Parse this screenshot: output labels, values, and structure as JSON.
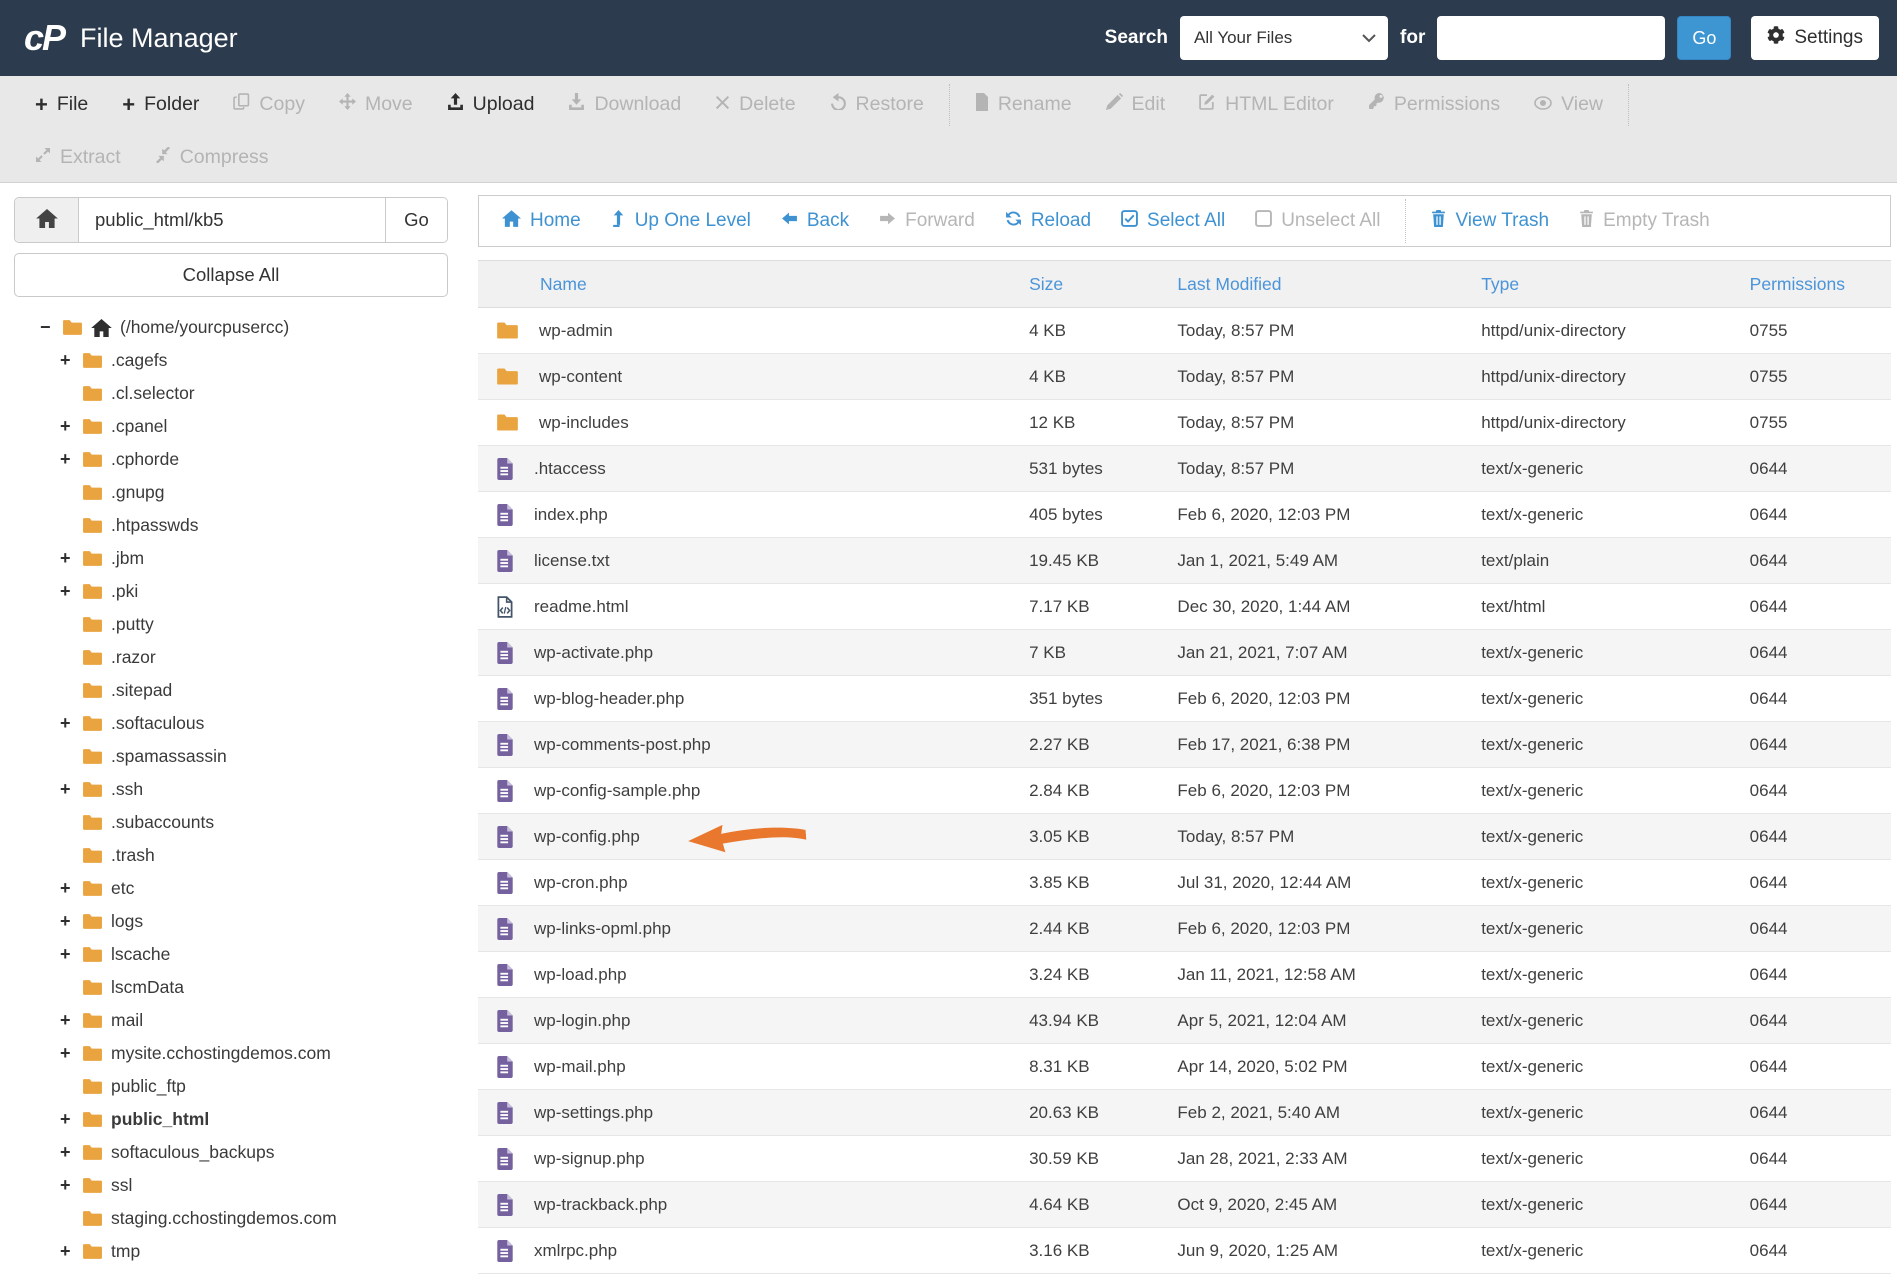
{
  "header": {
    "logo_text": "cP",
    "app_title": "File Manager",
    "search_label": "Search",
    "search_scope": "All Your Files",
    "for_label": "for",
    "search_placeholder": "",
    "go_label": "Go",
    "settings_label": "Settings"
  },
  "toolbar": {
    "file": "File",
    "folder": "Folder",
    "copy": "Copy",
    "move": "Move",
    "upload": "Upload",
    "download": "Download",
    "delete": "Delete",
    "restore": "Restore",
    "rename": "Rename",
    "edit": "Edit",
    "html_editor": "HTML Editor",
    "permissions": "Permissions",
    "view": "View",
    "extract": "Extract",
    "compress": "Compress"
  },
  "sidebar": {
    "path_value": "public_html/kb5",
    "go_label": "Go",
    "collapse_all_label": "Collapse All",
    "tree": [
      {
        "toggle": "-",
        "label": "(/home/yourcpusercc)",
        "root": true
      },
      {
        "toggle": "+",
        "label": ".cagefs"
      },
      {
        "toggle": "",
        "label": ".cl.selector"
      },
      {
        "toggle": "+",
        "label": ".cpanel"
      },
      {
        "toggle": "+",
        "label": ".cphorde"
      },
      {
        "toggle": "",
        "label": ".gnupg"
      },
      {
        "toggle": "",
        "label": ".htpasswds"
      },
      {
        "toggle": "+",
        "label": ".jbm"
      },
      {
        "toggle": "+",
        "label": ".pki"
      },
      {
        "toggle": "",
        "label": ".putty"
      },
      {
        "toggle": "",
        "label": ".razor"
      },
      {
        "toggle": "",
        "label": ".sitepad"
      },
      {
        "toggle": "+",
        "label": ".softaculous"
      },
      {
        "toggle": "",
        "label": ".spamassassin"
      },
      {
        "toggle": "+",
        "label": ".ssh"
      },
      {
        "toggle": "",
        "label": ".subaccounts"
      },
      {
        "toggle": "",
        "label": ".trash"
      },
      {
        "toggle": "+",
        "label": "etc"
      },
      {
        "toggle": "+",
        "label": "logs"
      },
      {
        "toggle": "+",
        "label": "lscache"
      },
      {
        "toggle": "",
        "label": "lscmData"
      },
      {
        "toggle": "+",
        "label": "mail"
      },
      {
        "toggle": "+",
        "label": "mysite.cchostingdemos.com"
      },
      {
        "toggle": "",
        "label": "public_ftp"
      },
      {
        "toggle": "+",
        "label": "public_html",
        "bold": true
      },
      {
        "toggle": "+",
        "label": "softaculous_backups"
      },
      {
        "toggle": "+",
        "label": "ssl"
      },
      {
        "toggle": "",
        "label": "staging.cchostingdemos.com"
      },
      {
        "toggle": "+",
        "label": "tmp"
      }
    ]
  },
  "filepane": {
    "nav": {
      "home": "Home",
      "up": "Up One Level",
      "back": "Back",
      "forward": "Forward",
      "reload": "Reload",
      "select_all": "Select All",
      "unselect_all": "Unselect All",
      "view_trash": "View Trash",
      "empty_trash": "Empty Trash"
    },
    "columns": [
      "Name",
      "Size",
      "Last Modified",
      "Type",
      "Permissions"
    ],
    "rows": [
      {
        "icon": "folder",
        "name": "wp-admin",
        "size": "4 KB",
        "modified": "Today, 8:57 PM",
        "type": "httpd/unix-directory",
        "perms": "0755"
      },
      {
        "icon": "folder",
        "name": "wp-content",
        "size": "4 KB",
        "modified": "Today, 8:57 PM",
        "type": "httpd/unix-directory",
        "perms": "0755"
      },
      {
        "icon": "folder",
        "name": "wp-includes",
        "size": "12 KB",
        "modified": "Today, 8:57 PM",
        "type": "httpd/unix-directory",
        "perms": "0755"
      },
      {
        "icon": "doc",
        "name": ".htaccess",
        "size": "531 bytes",
        "modified": "Today, 8:57 PM",
        "type": "text/x-generic",
        "perms": "0644"
      },
      {
        "icon": "doc",
        "name": "index.php",
        "size": "405 bytes",
        "modified": "Feb 6, 2020, 12:03 PM",
        "type": "text/x-generic",
        "perms": "0644"
      },
      {
        "icon": "doc",
        "name": "license.txt",
        "size": "19.45 KB",
        "modified": "Jan 1, 2021, 5:49 AM",
        "type": "text/plain",
        "perms": "0644"
      },
      {
        "icon": "code",
        "name": "readme.html",
        "size": "7.17 KB",
        "modified": "Dec 30, 2020, 1:44 AM",
        "type": "text/html",
        "perms": "0644"
      },
      {
        "icon": "doc",
        "name": "wp-activate.php",
        "size": "7 KB",
        "modified": "Jan 21, 2021, 7:07 AM",
        "type": "text/x-generic",
        "perms": "0644"
      },
      {
        "icon": "doc",
        "name": "wp-blog-header.php",
        "size": "351 bytes",
        "modified": "Feb 6, 2020, 12:03 PM",
        "type": "text/x-generic",
        "perms": "0644"
      },
      {
        "icon": "doc",
        "name": "wp-comments-post.php",
        "size": "2.27 KB",
        "modified": "Feb 17, 2021, 6:38 PM",
        "type": "text/x-generic",
        "perms": "0644"
      },
      {
        "icon": "doc",
        "name": "wp-config-sample.php",
        "size": "2.84 KB",
        "modified": "Feb 6, 2020, 12:03 PM",
        "type": "text/x-generic",
        "perms": "0644"
      },
      {
        "icon": "doc",
        "name": "wp-config.php",
        "size": "3.05 KB",
        "modified": "Today, 8:57 PM",
        "type": "text/x-generic",
        "perms": "0644",
        "arrow": true
      },
      {
        "icon": "doc",
        "name": "wp-cron.php",
        "size": "3.85 KB",
        "modified": "Jul 31, 2020, 12:44 AM",
        "type": "text/x-generic",
        "perms": "0644"
      },
      {
        "icon": "doc",
        "name": "wp-links-opml.php",
        "size": "2.44 KB",
        "modified": "Feb 6, 2020, 12:03 PM",
        "type": "text/x-generic",
        "perms": "0644"
      },
      {
        "icon": "doc",
        "name": "wp-load.php",
        "size": "3.24 KB",
        "modified": "Jan 11, 2021, 12:58 AM",
        "type": "text/x-generic",
        "perms": "0644"
      },
      {
        "icon": "doc",
        "name": "wp-login.php",
        "size": "43.94 KB",
        "modified": "Apr 5, 2021, 12:04 AM",
        "type": "text/x-generic",
        "perms": "0644"
      },
      {
        "icon": "doc",
        "name": "wp-mail.php",
        "size": "8.31 KB",
        "modified": "Apr 14, 2020, 5:02 PM",
        "type": "text/x-generic",
        "perms": "0644"
      },
      {
        "icon": "doc",
        "name": "wp-settings.php",
        "size": "20.63 KB",
        "modified": "Feb 2, 2021, 5:40 AM",
        "type": "text/x-generic",
        "perms": "0644"
      },
      {
        "icon": "doc",
        "name": "wp-signup.php",
        "size": "30.59 KB",
        "modified": "Jan 28, 2021, 2:33 AM",
        "type": "text/x-generic",
        "perms": "0644"
      },
      {
        "icon": "doc",
        "name": "wp-trackback.php",
        "size": "4.64 KB",
        "modified": "Oct 9, 2020, 2:45 AM",
        "type": "text/x-generic",
        "perms": "0644"
      },
      {
        "icon": "doc",
        "name": "xmlrpc.php",
        "size": "3.16 KB",
        "modified": "Jun 9, 2020, 1:25 AM",
        "type": "text/x-generic",
        "perms": "0644"
      }
    ]
  },
  "colors": {
    "header_navy": "#2c3b4d",
    "accent_blue": "#3d96d2",
    "link_blue": "#3e92d2",
    "folder_orange": "#e9a440",
    "file_purple": "#75619e",
    "arrow_orange": "#e9772e",
    "toolbar_bg": "#e8e8e8"
  }
}
